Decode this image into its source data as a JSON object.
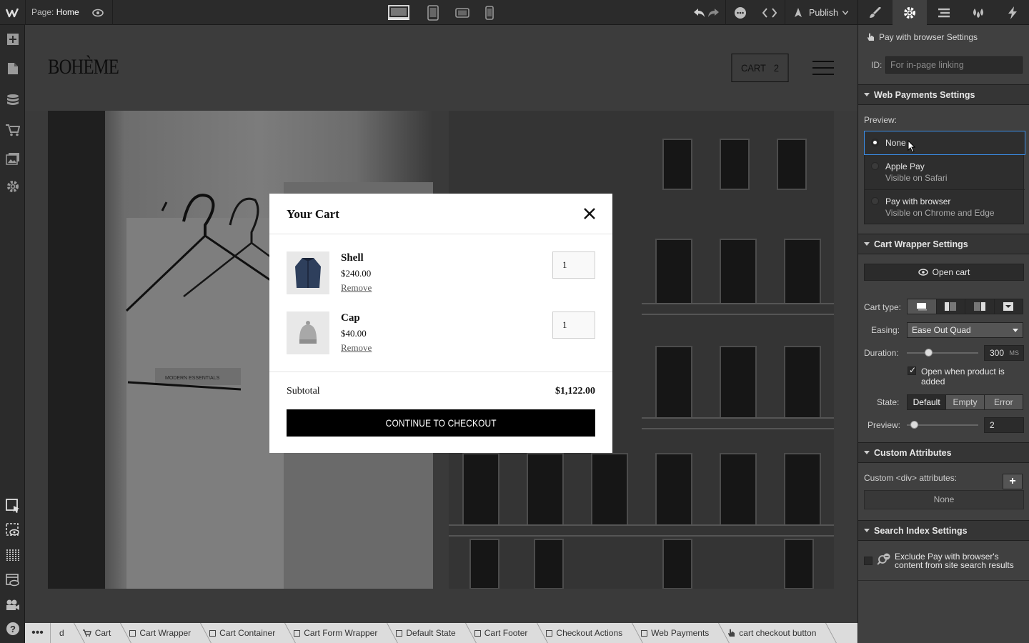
{
  "topbar": {
    "page_key": "Page:",
    "page_value": "Home",
    "publish_label": "Publish"
  },
  "site": {
    "brand": "BOHÈME",
    "cart_label": "CART",
    "cart_count": "2"
  },
  "cart_modal": {
    "title": "Your Cart",
    "items": [
      {
        "name": "Shell",
        "price": "$240.00",
        "remove": "Remove",
        "qty": "1"
      },
      {
        "name": "Cap",
        "price": "$40.00",
        "remove": "Remove",
        "qty": "1"
      }
    ],
    "subtotal_label": "Subtotal",
    "subtotal_value": "$1,122.00",
    "checkout_label": "CONTINUE TO CHECKOUT"
  },
  "breadcrumbs": {
    "more": "•••",
    "items": [
      "d",
      "Cart",
      "Cart Wrapper",
      "Cart Container",
      "Cart Form Wrapper",
      "Default State",
      "Cart Footer",
      "Checkout Actions",
      "Web Payments",
      "cart checkout button"
    ]
  },
  "panel": {
    "element_title": "Pay with browser Settings",
    "id_label": "ID:",
    "id_placeholder": "For in-page linking",
    "web_payments": {
      "heading": "Web Payments Settings",
      "preview_label": "Preview:",
      "options": [
        {
          "title": "None",
          "subtitle": "",
          "selected": true
        },
        {
          "title": "Apple Pay",
          "subtitle": "Visible on Safari",
          "selected": false
        },
        {
          "title": "Pay with browser",
          "subtitle": "Visible on Chrome and Edge",
          "selected": false
        }
      ]
    },
    "cart_wrapper": {
      "heading": "Cart Wrapper Settings",
      "open_cart": "Open cart",
      "cart_type_label": "Cart type:",
      "easing_label": "Easing:",
      "easing_value": "Ease Out Quad",
      "duration_label": "Duration:",
      "duration_value": "300",
      "duration_unit": "MS",
      "duration_level": 0.3,
      "open_when_added": "Open when product is added",
      "open_when_added_checked": true,
      "state_label": "State:",
      "states": [
        "Default",
        "Empty",
        "Error"
      ],
      "active_state": "Default",
      "preview_label": "Preview:",
      "preview_value": "2",
      "preview_level": 0.1
    },
    "custom_attributes": {
      "heading": "Custom Attributes",
      "label": "Custom <div> attributes:",
      "add_symbol": "+",
      "empty": "None"
    },
    "search_index": {
      "heading": "Search Index Settings",
      "exclude_line1": "Exclude Pay with browser's",
      "exclude_line2": "content from site search results",
      "checked": false
    }
  },
  "colors": {
    "selected_border": "#3b8ee8",
    "panel_bg": "#404040",
    "chrome_bg": "#2b2b2b"
  }
}
